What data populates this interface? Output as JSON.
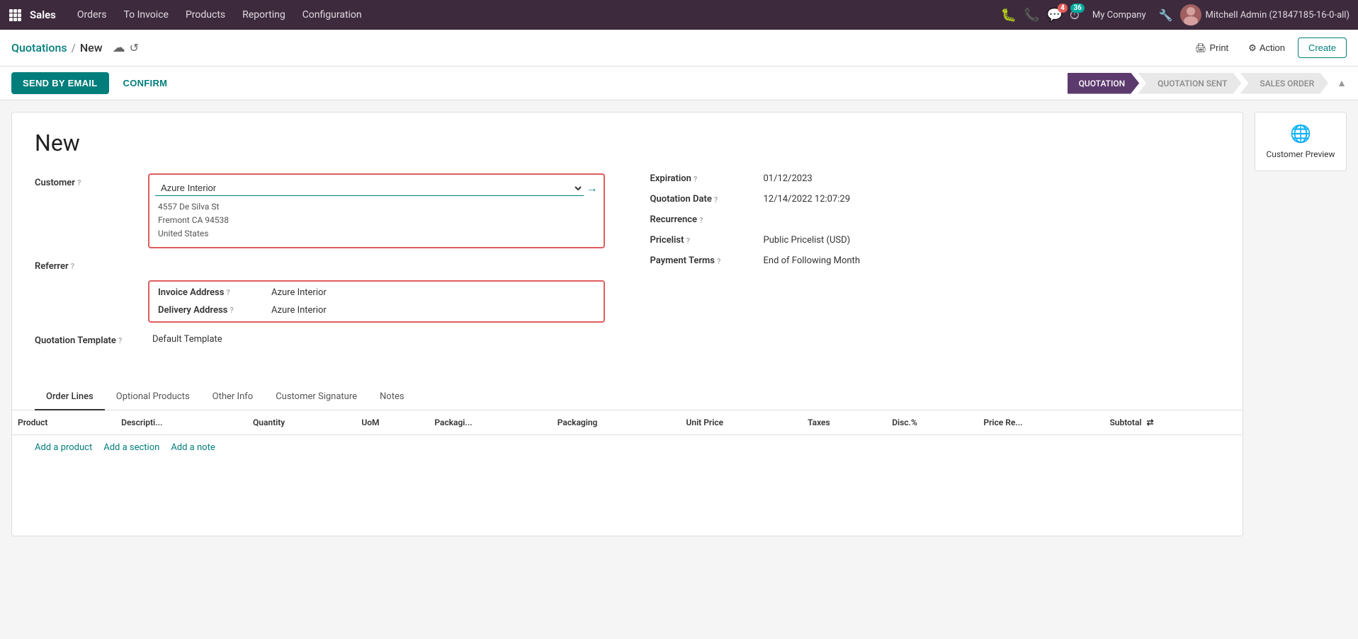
{
  "topnav": {
    "app": "Sales",
    "items": [
      "Orders",
      "To Invoice",
      "Products",
      "Reporting",
      "Configuration"
    ],
    "chat_badge": "4",
    "clock_badge": "36",
    "company": "My Company",
    "user": "Mitchell Admin (21847185-16-0-all)"
  },
  "breadcrumb": {
    "parent": "Quotations",
    "separator": "/",
    "current": "New"
  },
  "secnav": {
    "print_label": "Print",
    "action_label": "Action",
    "create_label": "Create"
  },
  "actionbar": {
    "send_email_label": "SEND BY EMAIL",
    "confirm_label": "CONFIRM"
  },
  "pipeline": {
    "steps": [
      {
        "label": "QUOTATION",
        "state": "active"
      },
      {
        "label": "QUOTATION SENT",
        "state": "inactive"
      },
      {
        "label": "SALES ORDER",
        "state": "inactive"
      }
    ]
  },
  "preview": {
    "label": "Customer Preview"
  },
  "form": {
    "title": "New",
    "customer": {
      "label": "Customer",
      "value": "Azure Interior",
      "address_line1": "4557 De Silva St",
      "address_line2": "Fremont CA 94538",
      "address_line3": "United States"
    },
    "referrer": {
      "label": "Referrer"
    },
    "invoice_address": {
      "label": "Invoice Address",
      "value": "Azure Interior"
    },
    "delivery_address": {
      "label": "Delivery Address",
      "value": "Azure Interior"
    },
    "quotation_template": {
      "label": "Quotation Template",
      "value": "Default Template"
    },
    "expiration": {
      "label": "Expiration",
      "value": "01/12/2023"
    },
    "quotation_date": {
      "label": "Quotation Date",
      "value": "12/14/2022 12:07:29"
    },
    "recurrence": {
      "label": "Recurrence",
      "value": ""
    },
    "pricelist": {
      "label": "Pricelist",
      "value": "Public Pricelist (USD)"
    },
    "payment_terms": {
      "label": "Payment Terms",
      "value": "End of Following Month"
    }
  },
  "tabs": [
    {
      "label": "Order Lines",
      "active": true
    },
    {
      "label": "Optional Products",
      "active": false
    },
    {
      "label": "Other Info",
      "active": false
    },
    {
      "label": "Customer Signature",
      "active": false
    },
    {
      "label": "Notes",
      "active": false
    }
  ],
  "table": {
    "columns": [
      "Product",
      "Descripti...",
      "Quantity",
      "UoM",
      "Packagi...",
      "Packaging",
      "Unit Price",
      "Taxes",
      "Disc.%",
      "Price Re...",
      "Subtotal"
    ],
    "rows": [],
    "actions": [
      {
        "label": "Add a product"
      },
      {
        "label": "Add a section"
      },
      {
        "label": "Add a note"
      }
    ]
  }
}
